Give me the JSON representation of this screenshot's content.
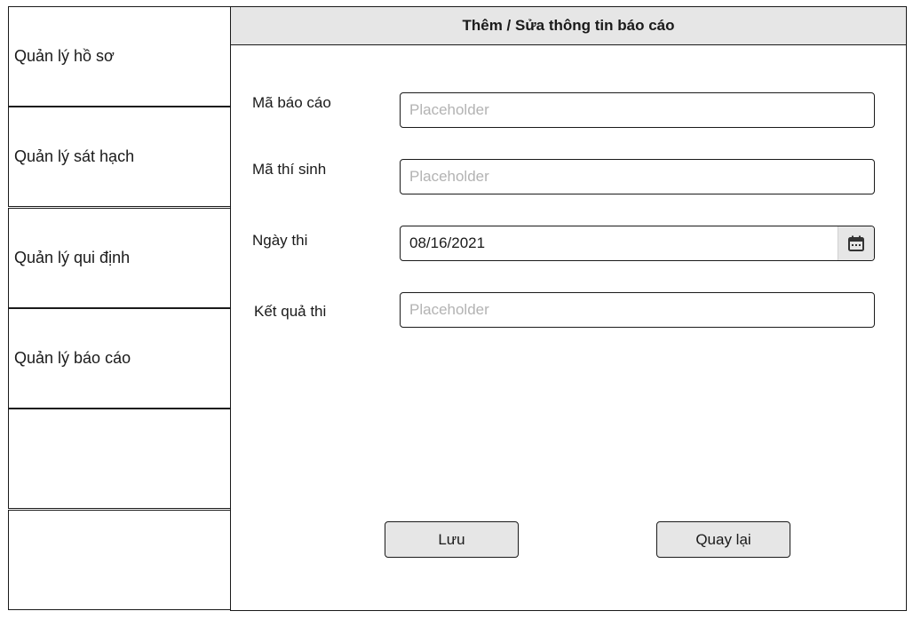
{
  "sidebar": {
    "items": [
      {
        "label": "Quản lý hồ sơ"
      },
      {
        "label": "Quản lý sát hạch"
      },
      {
        "label": "Quản lý qui định"
      },
      {
        "label": "Quản lý báo cáo"
      },
      {
        "label": ""
      },
      {
        "label": ""
      }
    ]
  },
  "form": {
    "title": "Thêm / Sửa thông tin báo cáo",
    "fields": {
      "report_id": {
        "label": "Mã báo cáo",
        "placeholder": "Placeholder",
        "value": ""
      },
      "candidate_id": {
        "label": "Mã thí sinh",
        "placeholder": "Placeholder",
        "value": ""
      },
      "exam_date": {
        "label": "Ngày thi",
        "value": "08/16/2021",
        "icon": "calendar-icon"
      },
      "exam_result": {
        "label": "Kết quả thi",
        "placeholder": "Placeholder",
        "value": ""
      }
    },
    "buttons": {
      "save_label": "Lưu",
      "back_label": "Quay lại"
    }
  }
}
